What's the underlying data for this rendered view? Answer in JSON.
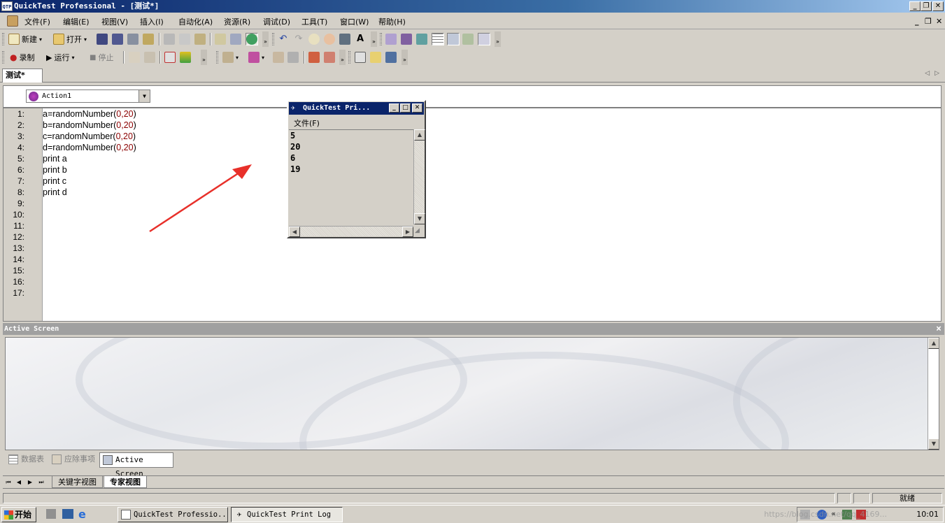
{
  "window": {
    "title": "QuickTest Professional - [测试*]",
    "app_icon": "QTP",
    "controls": [
      "_",
      "❐",
      "✕"
    ]
  },
  "menu": {
    "items": [
      "文件(F)",
      "编辑(E)",
      "视图(V)",
      "插入(I)",
      "自动化(A)",
      "资源(R)",
      "调试(D)",
      "工具(T)",
      "窗口(W)",
      "帮助(H)"
    ],
    "mdi_controls": [
      "_",
      "❐",
      "✕"
    ]
  },
  "toolbar1": {
    "new_label": "新建",
    "open_label": "打开"
  },
  "toolbar2": {
    "record_label": "录制",
    "run_label": "运行",
    "stop_label": "停止"
  },
  "doc_tab": {
    "label": "测试*"
  },
  "action_select": {
    "value": "Action1"
  },
  "editor": {
    "line_numbers": [
      "1:",
      "2:",
      "3:",
      "4:",
      "5:",
      "6:",
      "7:",
      "8:",
      "9:",
      "10:",
      "11:",
      "12:",
      "13:",
      "14:",
      "15:",
      "16:",
      "17:"
    ],
    "lines": [
      {
        "pre": "a=randomNumber(",
        "args": "0,20",
        "post": ")"
      },
      {
        "pre": "b=randomNumber(",
        "args": "0,20",
        "post": ")"
      },
      {
        "pre": "c=randomNumber(",
        "args": "0,20",
        "post": ")"
      },
      {
        "pre": "d=randomNumber(",
        "args": "0,20",
        "post": ")"
      },
      {
        "pre": "print a",
        "args": "",
        "post": ""
      },
      {
        "pre": "print b",
        "args": "",
        "post": ""
      },
      {
        "pre": "print c",
        "args": "",
        "post": ""
      },
      {
        "pre": "print d",
        "args": "",
        "post": ""
      }
    ]
  },
  "print_log": {
    "title": "QuickTest Pri...",
    "menu_label": "文件(F)",
    "output": [
      "5",
      "20",
      "6",
      "19"
    ]
  },
  "active_screen": {
    "title": "Active Screen",
    "close_label": "×"
  },
  "pane_tabs": {
    "data_table": "数据表",
    "missing_resources": "应除事项",
    "active_screen": "Active Screen"
  },
  "view_tabs": {
    "keyword_view": "关键字视图",
    "expert_view": "专家视图"
  },
  "status": {
    "ready": "就绪"
  },
  "taskbar": {
    "start_label": "开始",
    "tasks": [
      "QuickTest Professio...",
      "QuickTest Print Log"
    ],
    "clock": "10:01",
    "watermark": "https://blog.csdn.net/qq_4169..."
  },
  "colors": {
    "title_active": "#0a246a",
    "chrome": "#d4d0c8",
    "annotation_arrow": "#e8302a",
    "code_numbers": "#8b0000"
  }
}
